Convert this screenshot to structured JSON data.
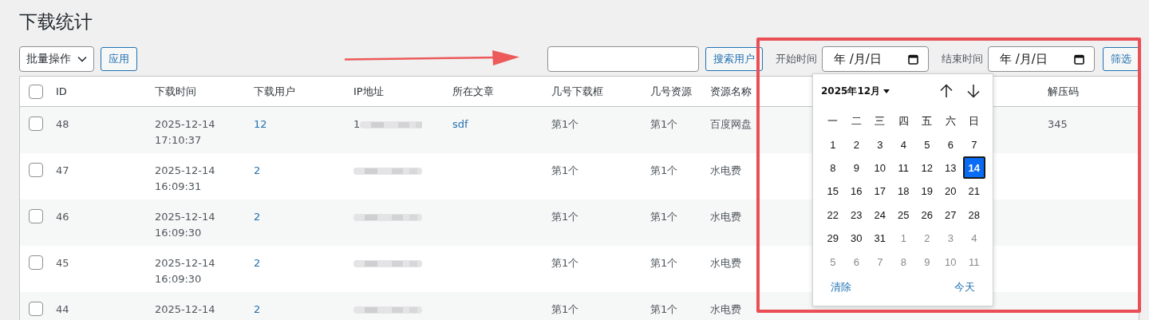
{
  "page_title": "下载统计",
  "bulk_action": {
    "value": "批量操作"
  },
  "apply_button": "应用",
  "search_button": "搜索用户",
  "filters": [
    {
      "label": "开始时间",
      "placeholder": "年 /月/日"
    },
    {
      "label": "结束时间",
      "placeholder": "年 /月/日"
    }
  ],
  "filter_button": "筛选",
  "table": {
    "select_all": {
      "checked": false
    },
    "columns": [
      "ID",
      "下载时间",
      "下载用户",
      "IP地址",
      "所在文章",
      "几号下载框",
      "几号资源",
      "资源名称",
      "解压码"
    ],
    "rows": [
      {
        "checked": false,
        "cells": [
          {
            "kind": "text",
            "text": "48"
          },
          {
            "kind": "text",
            "text": "2025-12-14 17:10:37"
          },
          {
            "kind": "link",
            "text": "12"
          },
          {
            "kind": "redacted",
            "text": "1"
          },
          {
            "kind": "link",
            "text": "sdf"
          },
          {
            "kind": "text",
            "text": "第1个"
          },
          {
            "kind": "text",
            "text": "第1个"
          },
          {
            "kind": "text",
            "text": "百度网盘"
          },
          {
            "kind": "text",
            "text": "345"
          }
        ]
      },
      {
        "checked": false,
        "cells": [
          {
            "kind": "text",
            "text": "47"
          },
          {
            "kind": "text",
            "text": "2025-12-14 16:09:31"
          },
          {
            "kind": "link",
            "text": "2"
          },
          {
            "kind": "redacted"
          },
          {
            "kind": "empty"
          },
          {
            "kind": "text",
            "text": "第1个"
          },
          {
            "kind": "text",
            "text": "第1个"
          },
          {
            "kind": "text",
            "text": "水电费"
          },
          {
            "kind": "empty"
          }
        ]
      },
      {
        "checked": false,
        "cells": [
          {
            "kind": "text",
            "text": "46"
          },
          {
            "kind": "text",
            "text": "2025-12-14 16:09:30"
          },
          {
            "kind": "link",
            "text": "2"
          },
          {
            "kind": "redacted"
          },
          {
            "kind": "empty"
          },
          {
            "kind": "text",
            "text": "第1个"
          },
          {
            "kind": "text",
            "text": "第1个"
          },
          {
            "kind": "text",
            "text": "水电费"
          },
          {
            "kind": "empty"
          }
        ]
      },
      {
        "checked": false,
        "cells": [
          {
            "kind": "text",
            "text": "45"
          },
          {
            "kind": "text",
            "text": "2025-12-14 16:09:30"
          },
          {
            "kind": "link",
            "text": "2"
          },
          {
            "kind": "redacted"
          },
          {
            "kind": "empty"
          },
          {
            "kind": "text",
            "text": "第1个"
          },
          {
            "kind": "text",
            "text": "第1个"
          },
          {
            "kind": "text",
            "text": "水电费"
          },
          {
            "kind": "empty"
          }
        ]
      },
      {
        "checked": false,
        "cells": [
          {
            "kind": "text",
            "text": "44"
          },
          {
            "kind": "text",
            "text": "2025-12-14"
          },
          {
            "kind": "link",
            "text": "2"
          },
          {
            "kind": "redacted"
          },
          {
            "kind": "empty"
          },
          {
            "kind": "text",
            "text": "第1个"
          },
          {
            "kind": "text",
            "text": "第1个"
          },
          {
            "kind": "text",
            "text": "水电费"
          },
          {
            "kind": "empty"
          }
        ]
      }
    ]
  },
  "date_picker": {
    "month_label": "2025年12月",
    "weekdays": [
      "一",
      "二",
      "三",
      "四",
      "五",
      "六",
      "日"
    ],
    "days": [
      {
        "label": "1",
        "kind": "current",
        "selected": false
      },
      {
        "label": "2",
        "kind": "current",
        "selected": false
      },
      {
        "label": "3",
        "kind": "current",
        "selected": false
      },
      {
        "label": "4",
        "kind": "current",
        "selected": false
      },
      {
        "label": "5",
        "kind": "current",
        "selected": false
      },
      {
        "label": "6",
        "kind": "current",
        "selected": false
      },
      {
        "label": "7",
        "kind": "current",
        "selected": false
      },
      {
        "label": "8",
        "kind": "current",
        "selected": false
      },
      {
        "label": "9",
        "kind": "current",
        "selected": false
      },
      {
        "label": "10",
        "kind": "current",
        "selected": false
      },
      {
        "label": "11",
        "kind": "current",
        "selected": false
      },
      {
        "label": "12",
        "kind": "current",
        "selected": false
      },
      {
        "label": "13",
        "kind": "current",
        "selected": false
      },
      {
        "label": "14",
        "kind": "current",
        "selected": true
      },
      {
        "label": "15",
        "kind": "current",
        "selected": false
      },
      {
        "label": "16",
        "kind": "current",
        "selected": false
      },
      {
        "label": "17",
        "kind": "current",
        "selected": false
      },
      {
        "label": "18",
        "kind": "current",
        "selected": false
      },
      {
        "label": "19",
        "kind": "current",
        "selected": false
      },
      {
        "label": "20",
        "kind": "current",
        "selected": false
      },
      {
        "label": "21",
        "kind": "current",
        "selected": false
      },
      {
        "label": "22",
        "kind": "current",
        "selected": false
      },
      {
        "label": "23",
        "kind": "current",
        "selected": false
      },
      {
        "label": "24",
        "kind": "current",
        "selected": false
      },
      {
        "label": "25",
        "kind": "current",
        "selected": false
      },
      {
        "label": "26",
        "kind": "current",
        "selected": false
      },
      {
        "label": "27",
        "kind": "current",
        "selected": false
      },
      {
        "label": "28",
        "kind": "current",
        "selected": false
      },
      {
        "label": "29",
        "kind": "current",
        "selected": false
      },
      {
        "label": "30",
        "kind": "current",
        "selected": false
      },
      {
        "label": "31",
        "kind": "current",
        "selected": false
      },
      {
        "label": "1",
        "kind": "other",
        "selected": false
      },
      {
        "label": "2",
        "kind": "other",
        "selected": false
      },
      {
        "label": "3",
        "kind": "other",
        "selected": false
      },
      {
        "label": "4",
        "kind": "other",
        "selected": false
      },
      {
        "label": "5",
        "kind": "other",
        "selected": false
      },
      {
        "label": "6",
        "kind": "other",
        "selected": false
      },
      {
        "label": "7",
        "kind": "other",
        "selected": false
      },
      {
        "label": "8",
        "kind": "other",
        "selected": false
      },
      {
        "label": "9",
        "kind": "other",
        "selected": false
      },
      {
        "label": "10",
        "kind": "other",
        "selected": false
      },
      {
        "label": "11",
        "kind": "other",
        "selected": false
      }
    ],
    "clear_button": "清除",
    "today_button": "今天"
  },
  "annotations": {
    "arrow": true,
    "frame": true
  }
}
